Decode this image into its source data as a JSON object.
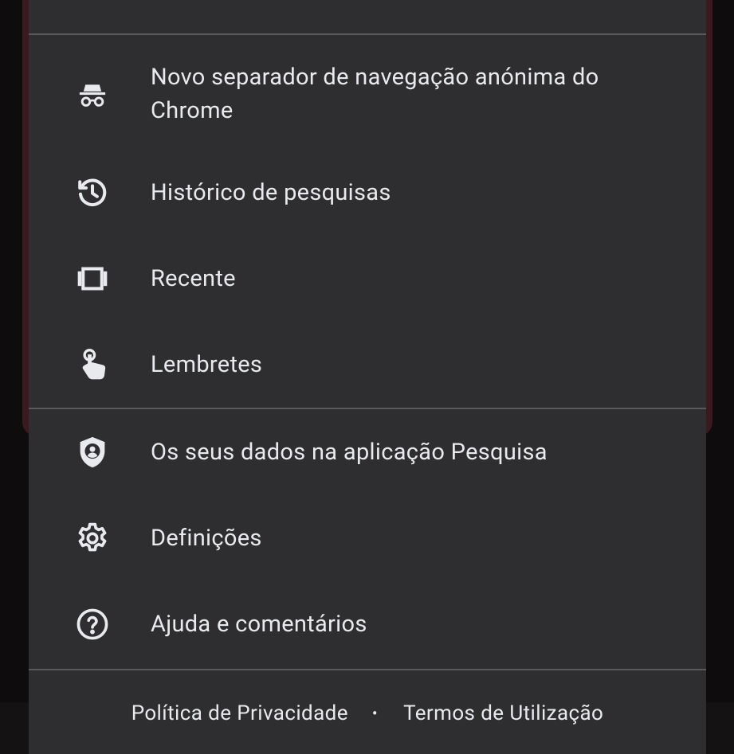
{
  "menu": {
    "items": [
      {
        "id": "incognito",
        "icon": "incognito-icon",
        "label": "Novo separador de navegação anónima do Chrome"
      },
      {
        "id": "history",
        "icon": "history-icon",
        "label": "Histórico de pesquisas"
      },
      {
        "id": "recent",
        "icon": "recent-carousel-icon",
        "label": "Recente"
      },
      {
        "id": "reminders",
        "icon": "reminder-tap-icon",
        "label": "Lembretes"
      },
      {
        "id": "your-data",
        "icon": "shield-account-icon",
        "label": "Os seus dados na aplicação Pesquisa"
      },
      {
        "id": "settings",
        "icon": "gear-icon",
        "label": "Definições"
      },
      {
        "id": "help",
        "icon": "help-circle-icon",
        "label": "Ajuda e comentários"
      }
    ]
  },
  "footer": {
    "privacy_label": "Política de Privacidade",
    "separator": "•",
    "terms_label": "Termos de Utilização"
  },
  "colors": {
    "sheet_background": "#2e2e30",
    "divider": "#5a5a5d",
    "text": "#e8eaed",
    "backdrop": "#0e0c0d",
    "background_card": "#3a1a1e"
  }
}
